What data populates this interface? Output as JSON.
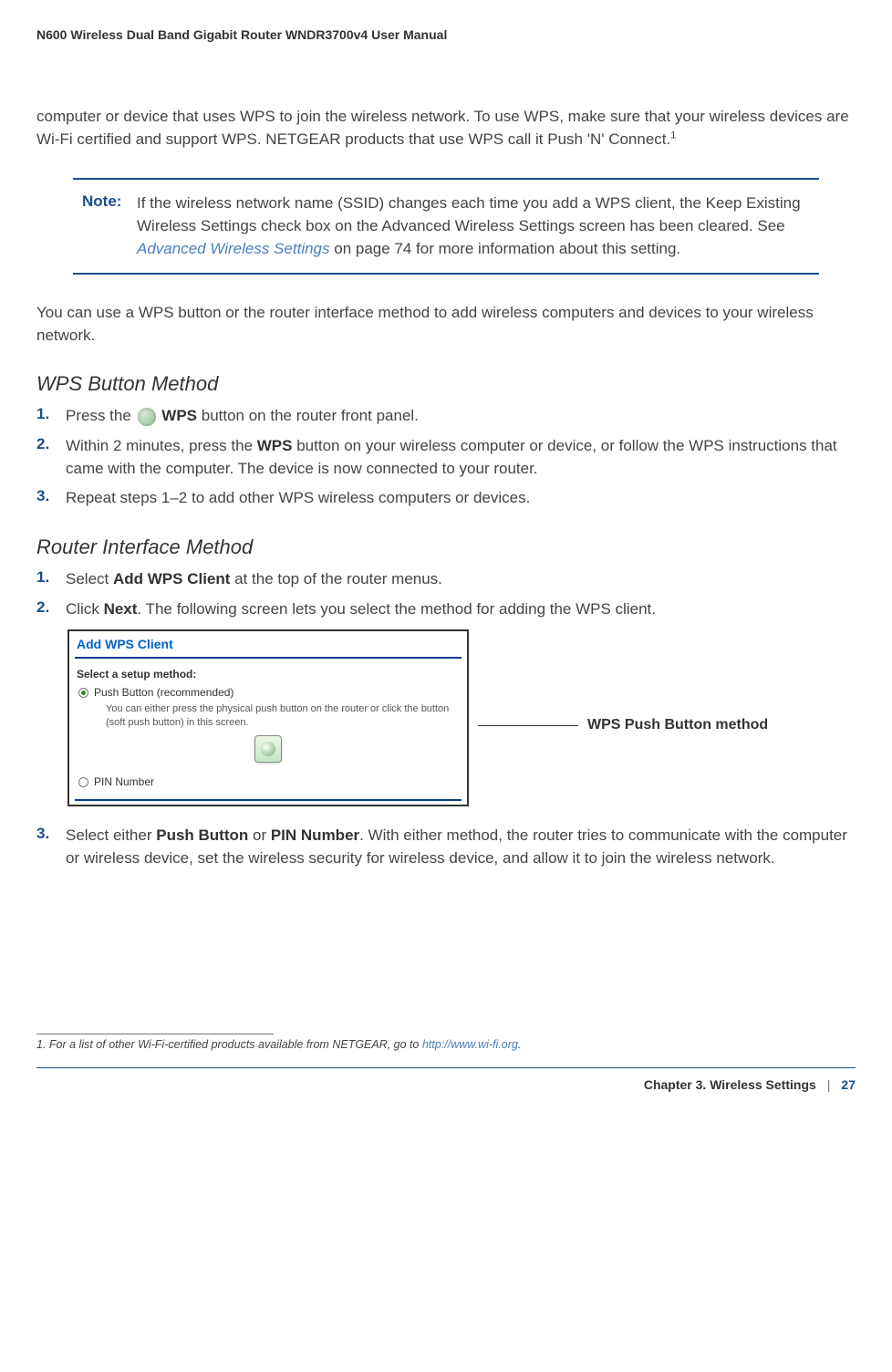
{
  "running_head": "N600 Wireless Dual Band Gigabit Router WNDR3700v4 User Manual",
  "intro_paragraph_pre": "computer or device that uses WPS to join the wireless network. To use WPS, make sure that your wireless devices are Wi-Fi certified and support WPS. NETGEAR products that use WPS call it Push 'N' Connect.",
  "intro_sup": "1",
  "note": {
    "label": "Note:",
    "text_before_link": "If the wireless network name (SSID) changes each time you add a WPS client, the Keep Existing Wireless Settings check box on the Advanced Wireless Settings screen has been cleared. See ",
    "link": "Advanced Wireless Settings",
    "text_after_link": " on page 74 for more information about this setting."
  },
  "after_note": "You can use a WPS button or the router interface method to add wireless computers and devices to your wireless network.",
  "section1": {
    "title": "WPS Button Method",
    "steps": [
      {
        "num": "1.",
        "pre": "Press the ",
        "bold": "WPS",
        "post": " button on the router front panel.",
        "has_icon": true
      },
      {
        "num": "2.",
        "pre": "Within 2 minutes, press the ",
        "bold": "WPS",
        "post": " button on your wireless computer or device, or follow the WPS instructions that came with the computer. The device is now connected to your router."
      },
      {
        "num": "3.",
        "text": "Repeat steps 1–2 to add other WPS wireless computers or devices."
      }
    ]
  },
  "section2": {
    "title": "Router Interface Method",
    "steps_top": [
      {
        "num": "1.",
        "pre": "Select ",
        "bold": "Add WPS Client",
        "post": " at the top of the router menus."
      },
      {
        "num": "2.",
        "pre": "Click ",
        "bold": "Next",
        "post": ". The following screen lets you select the method for adding the WPS client."
      }
    ],
    "screenshot": {
      "title": "Add WPS Client",
      "select_label": "Select a setup method:",
      "option1": "Push Button (recommended)",
      "help": "You can either press the physical push button on the router or click the button (soft push button) in this screen.",
      "option2": "PIN Number"
    },
    "annotation": "WPS Push Button method",
    "step3": {
      "num": "3.",
      "pre": "Select either ",
      "bold1": "Push Button",
      "mid": " or ",
      "bold2": "PIN Number",
      "post": ". With either method, the router tries to communicate with the computer or wireless device, set the wireless security for wireless device, and allow it to join the wireless network."
    }
  },
  "footnote": {
    "num": "1. ",
    "text": "For a list of other Wi-Fi-certified products available from NETGEAR, go to ",
    "link": "http://www.wi-fi.org",
    "tail": "."
  },
  "footer": {
    "chapter": "Chapter 3.  Wireless Settings",
    "sep": "|",
    "page": "27"
  }
}
